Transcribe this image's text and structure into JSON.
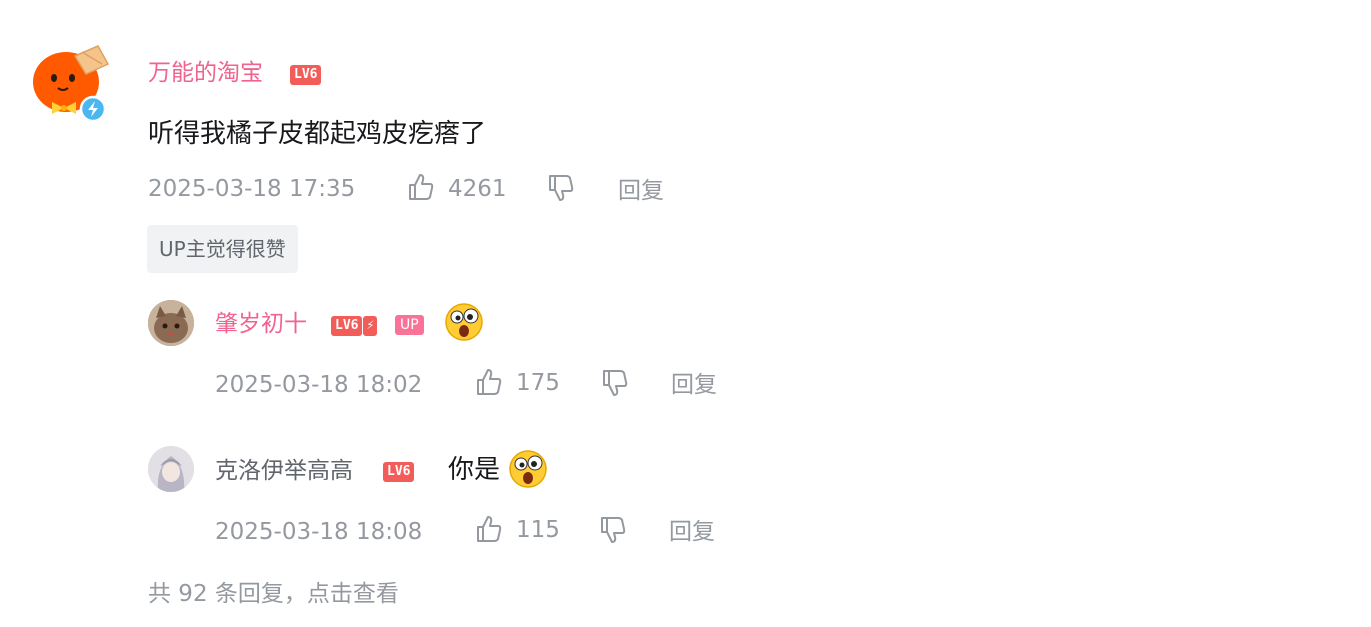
{
  "comment": {
    "user_name": "万能的淘宝",
    "level": "LV6",
    "content": "听得我橘子皮都起鸡皮疙瘩了",
    "time": "2025-03-18 17:35",
    "likes": "4261",
    "reply_label": "回复",
    "up_liked_tag": "UP主觉得很赞"
  },
  "replies": [
    {
      "user_name": "肇岁初十",
      "level": "LV6",
      "up_badge": "UP",
      "time": "2025-03-18 18:02",
      "likes": "175",
      "reply_label": "回复"
    },
    {
      "user_name": "克洛伊举高高",
      "level": "LV6",
      "content": "你是",
      "time": "2025-03-18 18:08",
      "likes": "115",
      "reply_label": "回复"
    }
  ],
  "more_replies": "共 92 条回复，点击查看",
  "colors": {
    "username_pink": "#f1628f",
    "level_red": "#f25d59",
    "up_badge_pink": "#fb7299",
    "meta_gray": "#9499a0",
    "verify_blue": "#4ab7f0"
  }
}
